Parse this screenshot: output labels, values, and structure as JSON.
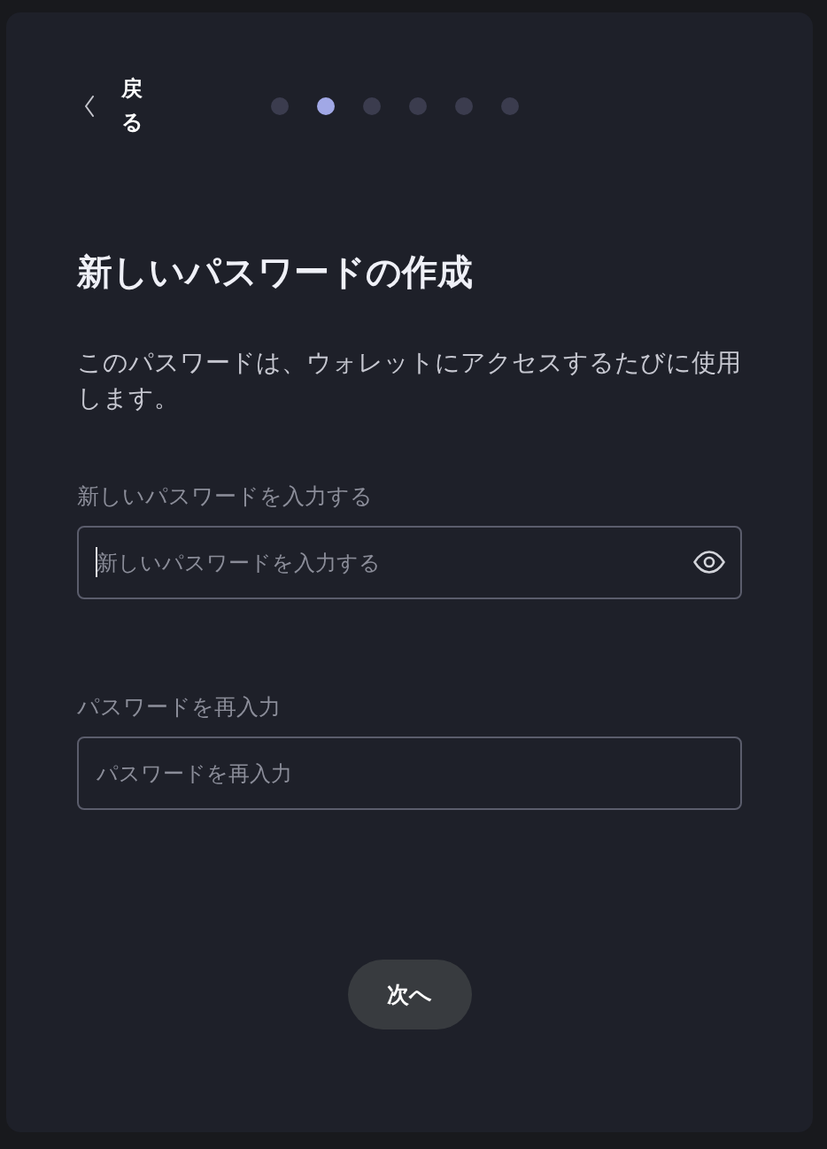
{
  "header": {
    "back_button": {
      "label": "戻る"
    },
    "steps": [
      {
        "selected": false
      },
      {
        "selected": true
      },
      {
        "selected": false
      },
      {
        "selected": false
      },
      {
        "selected": false
      },
      {
        "selected": false
      }
    ]
  },
  "title": "新しいパスワードの作成",
  "description": "このパスワードは、ウォレットにアクセスするたびに使用します。",
  "fields": [
    {
      "label": "新しいパスワードを入力する",
      "placeholder": "新しいパスワードを入力する",
      "focused": true,
      "reveal_toggle": true
    },
    {
      "label": "パスワードを再入力",
      "placeholder": "パスワードを再入力",
      "focused": false,
      "reveal_toggle": false
    }
  ],
  "next_button": {
    "label": "次へ"
  }
}
